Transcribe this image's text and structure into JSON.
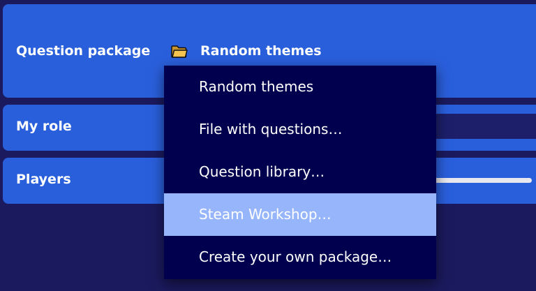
{
  "settings": {
    "question_package": {
      "label": "Question package",
      "icon": "folder-icon",
      "value": "Random themes"
    },
    "my_role": {
      "label": "My role"
    },
    "players": {
      "label": "Players"
    }
  },
  "package_menu": {
    "highlighted_index": 3,
    "items": [
      {
        "label": "Random themes"
      },
      {
        "label": "File with questions…"
      },
      {
        "label": "Question library…"
      },
      {
        "label": "Steam Workshop…"
      },
      {
        "label": "Create your own package…"
      }
    ]
  },
  "colors": {
    "background": "#1b1a5e",
    "panel": "#2a5fdc",
    "menu_background": "#00004f",
    "menu_highlight": "#96b5fb",
    "folder": "#f5c451"
  }
}
